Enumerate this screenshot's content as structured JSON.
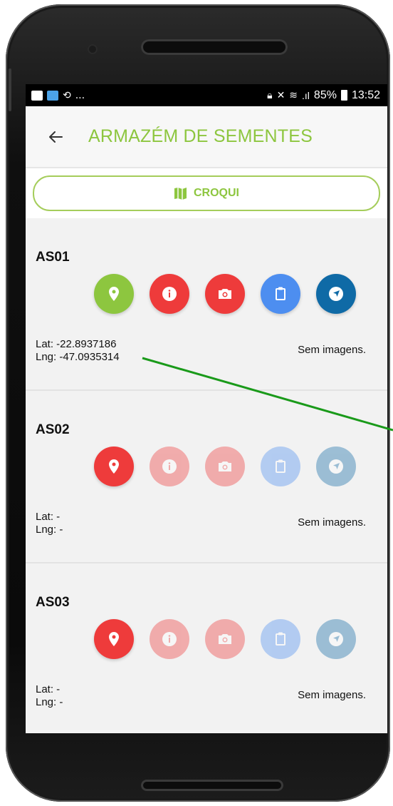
{
  "status_bar": {
    "battery": "85%",
    "time": "13:52",
    "left_ellipsis": "..."
  },
  "app_bar": {
    "title": "ARMAZÉM DE SEMENTES"
  },
  "croqui": {
    "label": "CROQUI"
  },
  "items": [
    {
      "id": "AS01",
      "lat": "Lat: -22.8937186",
      "lng": "Lng: -47.0935314",
      "images": "Sem imagens.",
      "location_set": true
    },
    {
      "id": "AS02",
      "lat": "Lat: -",
      "lng": "Lng: -",
      "images": "Sem imagens.",
      "location_set": false
    },
    {
      "id": "AS03",
      "lat": "Lat: -",
      "lng": "Lng: -",
      "images": "Sem imagens.",
      "location_set": false
    }
  ],
  "colors": {
    "accent": "#8dc63f",
    "red": "#ee3b3b",
    "blue": "#4d8ef0",
    "navy": "#0f6aa6",
    "annotation": "#1a9a1a"
  },
  "icons": [
    "map-marker-icon",
    "info-icon",
    "camera-icon",
    "clipboard-icon",
    "navigation-icon",
    "map-icon",
    "back-arrow-icon"
  ]
}
